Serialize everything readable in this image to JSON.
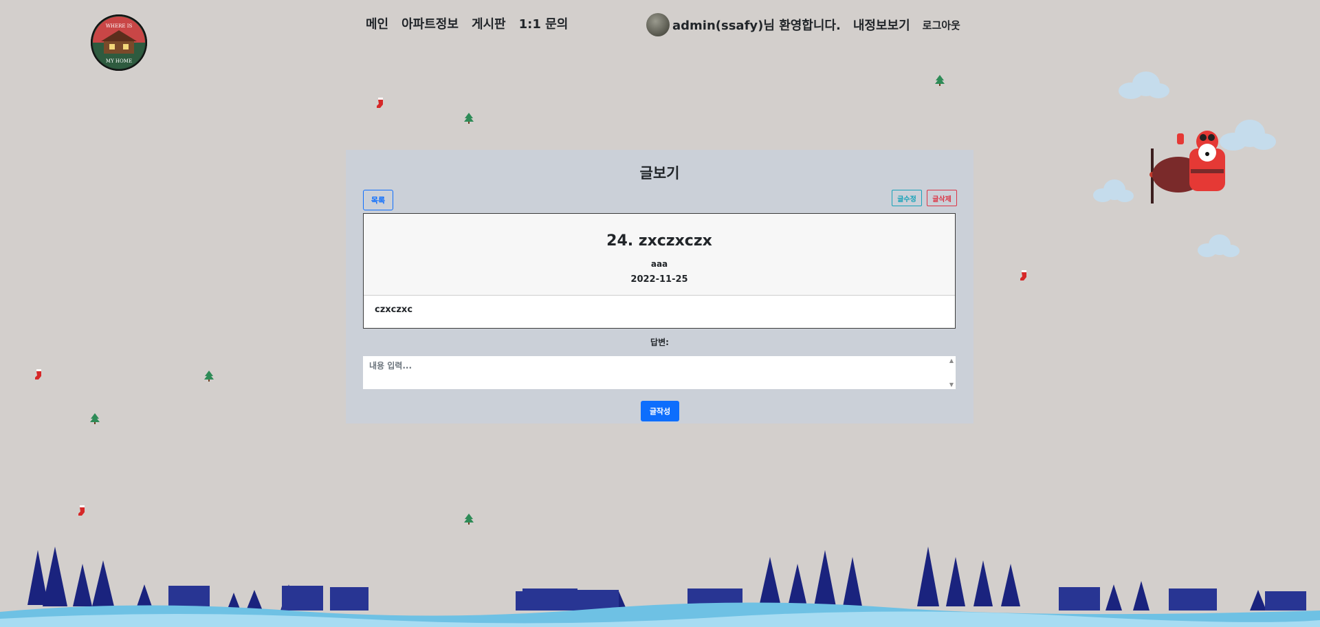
{
  "nav": {
    "items": [
      "메인",
      "아파트정보",
      "게시판",
      "1:1 문의"
    ]
  },
  "user": {
    "welcome": "admin(ssafy)님 환영합니다.",
    "mypage": "내정보보기",
    "logout": "로그아웃"
  },
  "logo": {
    "text_top": "WHERE IS",
    "text_bottom": "MY HOME"
  },
  "panel": {
    "title": "글보기",
    "list_button": "목록",
    "edit_button": "글수정",
    "delete_button": "글삭제",
    "post": {
      "title": "24. zxczxczx",
      "author": "aaa",
      "date": "2022-11-25",
      "content": "czxczxc"
    },
    "answer_label": "답변:",
    "answer_placeholder": "내용 입력...",
    "write_button": "글작성"
  },
  "colors": {
    "background": "#d3cfcc",
    "panel": "#cbd0d8",
    "primary": "#0d6efd",
    "info": "#17a2b8",
    "danger": "#dc3545"
  }
}
